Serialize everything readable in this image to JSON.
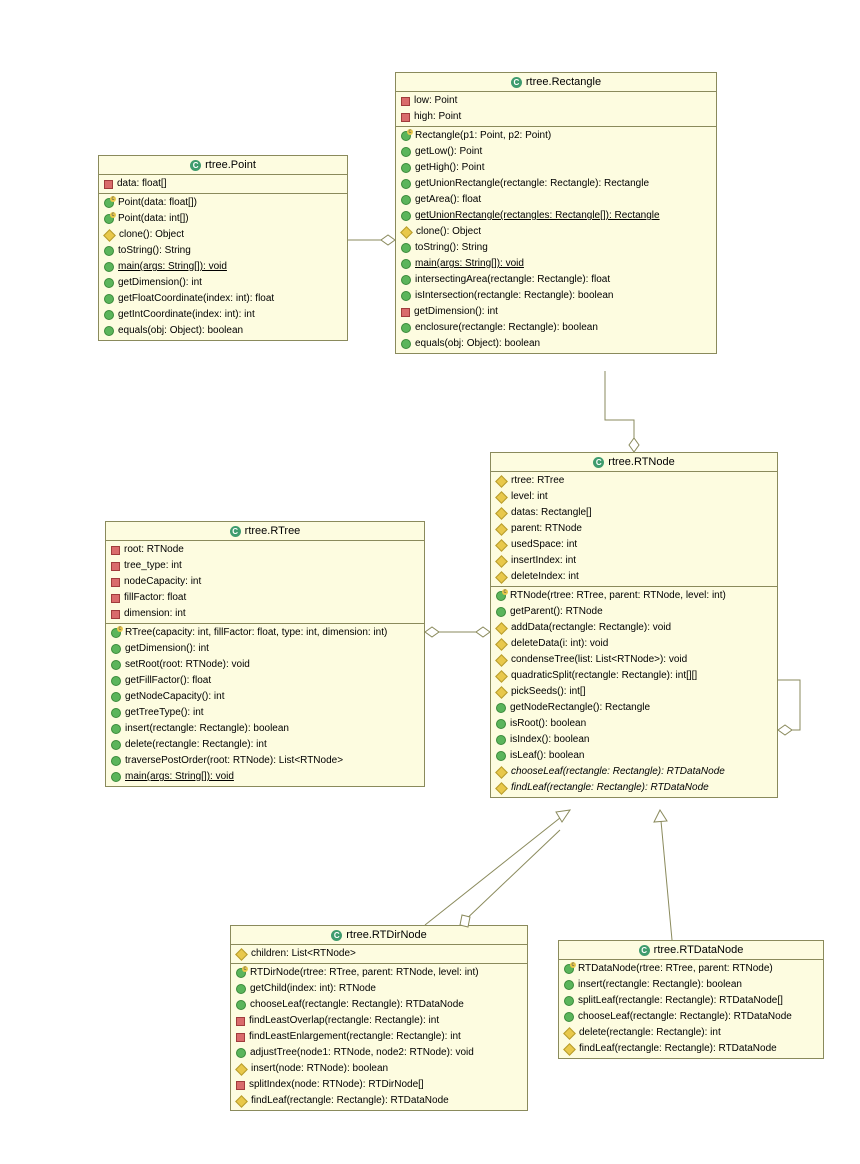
{
  "classes": {
    "point": {
      "title": "rtree.Point",
      "fields": [
        {
          "vis": "red-square",
          "text": "data: float[]"
        }
      ],
      "methods": [
        {
          "vis": "green-circle",
          "ctor": true,
          "text": "Point(data: float[])"
        },
        {
          "vis": "green-circle",
          "ctor": true,
          "text": "Point(data: int[])"
        },
        {
          "vis": "yellow-diamond",
          "text": "clone(): Object"
        },
        {
          "vis": "green-circle",
          "text": "toString(): String"
        },
        {
          "vis": "green-circle",
          "static": true,
          "text": "main(args: String[]): void"
        },
        {
          "vis": "green-circle",
          "text": "getDimension(): int"
        },
        {
          "vis": "green-circle",
          "text": "getFloatCoordinate(index: int): float"
        },
        {
          "vis": "green-circle",
          "text": "getIntCoordinate(index: int): int"
        },
        {
          "vis": "green-circle",
          "text": "equals(obj: Object): boolean"
        }
      ]
    },
    "rectangle": {
      "title": "rtree.Rectangle",
      "fields": [
        {
          "vis": "red-square",
          "text": "low: Point"
        },
        {
          "vis": "red-square",
          "text": "high: Point"
        }
      ],
      "methods": [
        {
          "vis": "green-circle",
          "ctor": true,
          "text": "Rectangle(p1: Point, p2: Point)"
        },
        {
          "vis": "green-circle",
          "text": "getLow(): Point"
        },
        {
          "vis": "green-circle",
          "text": "getHigh(): Point"
        },
        {
          "vis": "green-circle",
          "text": "getUnionRectangle(rectangle: Rectangle): Rectangle"
        },
        {
          "vis": "green-circle",
          "text": "getArea(): float"
        },
        {
          "vis": "green-circle",
          "static": true,
          "text": "getUnionRectangle(rectangles: Rectangle[]): Rectangle"
        },
        {
          "vis": "yellow-diamond",
          "text": "clone(): Object"
        },
        {
          "vis": "green-circle",
          "text": "toString(): String"
        },
        {
          "vis": "green-circle",
          "static": true,
          "text": "main(args: String[]): void"
        },
        {
          "vis": "green-circle",
          "text": "intersectingArea(rectangle: Rectangle): float"
        },
        {
          "vis": "green-circle",
          "text": "isIntersection(rectangle: Rectangle): boolean"
        },
        {
          "vis": "red-square",
          "text": "getDimension(): int"
        },
        {
          "vis": "green-circle",
          "text": "enclosure(rectangle: Rectangle): boolean"
        },
        {
          "vis": "green-circle",
          "text": "equals(obj: Object): boolean"
        }
      ]
    },
    "rtree": {
      "title": "rtree.RTree",
      "fields": [
        {
          "vis": "red-square",
          "text": "root: RTNode"
        },
        {
          "vis": "red-square",
          "text": "tree_type: int"
        },
        {
          "vis": "red-square",
          "text": "nodeCapacity: int"
        },
        {
          "vis": "red-square",
          "text": "fillFactor: float"
        },
        {
          "vis": "red-square",
          "text": "dimension: int"
        }
      ],
      "methods": [
        {
          "vis": "green-circle",
          "ctor": true,
          "text": "RTree(capacity: int, fillFactor: float, type: int, dimension: int)"
        },
        {
          "vis": "green-circle",
          "text": "getDimension(): int"
        },
        {
          "vis": "green-circle",
          "text": "setRoot(root: RTNode): void"
        },
        {
          "vis": "green-circle",
          "text": "getFillFactor(): float"
        },
        {
          "vis": "green-circle",
          "text": "getNodeCapacity(): int"
        },
        {
          "vis": "green-circle",
          "text": "getTreeType(): int"
        },
        {
          "vis": "green-circle",
          "text": "insert(rectangle: Rectangle): boolean"
        },
        {
          "vis": "green-circle",
          "text": "delete(rectangle: Rectangle): int"
        },
        {
          "vis": "green-circle",
          "text": "traversePostOrder(root: RTNode): List<RTNode>"
        },
        {
          "vis": "green-circle",
          "static": true,
          "text": "main(args: String[]): void"
        }
      ]
    },
    "rtnode": {
      "title": "rtree.RTNode",
      "fields": [
        {
          "vis": "yellow-diamond",
          "text": "rtree: RTree"
        },
        {
          "vis": "yellow-diamond",
          "text": "level: int"
        },
        {
          "vis": "yellow-diamond",
          "text": "datas: Rectangle[]"
        },
        {
          "vis": "yellow-diamond",
          "text": "parent: RTNode"
        },
        {
          "vis": "yellow-diamond",
          "text": "usedSpace: int"
        },
        {
          "vis": "yellow-diamond",
          "text": "insertIndex: int"
        },
        {
          "vis": "yellow-diamond",
          "text": "deleteIndex: int"
        }
      ],
      "methods": [
        {
          "vis": "green-circle",
          "ctor": true,
          "text": "RTNode(rtree: RTree, parent: RTNode, level: int)"
        },
        {
          "vis": "green-circle",
          "text": "getParent(): RTNode"
        },
        {
          "vis": "yellow-diamond",
          "text": "addData(rectangle: Rectangle): void"
        },
        {
          "vis": "yellow-diamond",
          "text": "deleteData(i: int): void"
        },
        {
          "vis": "yellow-diamond",
          "text": "condenseTree(list: List<RTNode>): void"
        },
        {
          "vis": "yellow-diamond",
          "text": "quadraticSplit(rectangle: Rectangle): int[][]"
        },
        {
          "vis": "yellow-diamond",
          "text": "pickSeeds(): int[]"
        },
        {
          "vis": "green-circle",
          "text": "getNodeRectangle(): Rectangle"
        },
        {
          "vis": "green-circle",
          "text": "isRoot(): boolean"
        },
        {
          "vis": "green-circle",
          "text": "isIndex(): boolean"
        },
        {
          "vis": "green-circle",
          "text": "isLeaf(): boolean"
        },
        {
          "vis": "yellow-diamond",
          "abstract": true,
          "text": "chooseLeaf(rectangle: Rectangle): RTDataNode"
        },
        {
          "vis": "yellow-diamond",
          "abstract": true,
          "text": "findLeaf(rectangle: Rectangle): RTDataNode"
        }
      ]
    },
    "rtdirnode": {
      "title": "rtree.RTDirNode",
      "fields": [
        {
          "vis": "yellow-diamond",
          "text": "children: List<RTNode>"
        }
      ],
      "methods": [
        {
          "vis": "green-circle",
          "ctor": true,
          "text": "RTDirNode(rtree: RTree, parent: RTNode, level: int)"
        },
        {
          "vis": "green-circle",
          "text": "getChild(index: int): RTNode"
        },
        {
          "vis": "green-circle",
          "text": "chooseLeaf(rectangle: Rectangle): RTDataNode"
        },
        {
          "vis": "red-square",
          "text": "findLeastOverlap(rectangle: Rectangle): int"
        },
        {
          "vis": "red-square",
          "text": "findLeastEnlargement(rectangle: Rectangle): int"
        },
        {
          "vis": "green-circle",
          "text": "adjustTree(node1: RTNode, node2: RTNode): void"
        },
        {
          "vis": "yellow-diamond",
          "text": "insert(node: RTNode): boolean"
        },
        {
          "vis": "red-square",
          "text": "splitIndex(node: RTNode): RTDirNode[]"
        },
        {
          "vis": "yellow-diamond",
          "text": "findLeaf(rectangle: Rectangle): RTDataNode"
        }
      ]
    },
    "rtdatanode": {
      "title": "rtree.RTDataNode",
      "fields": [],
      "methods": [
        {
          "vis": "green-circle",
          "ctor": true,
          "text": "RTDataNode(rtree: RTree, parent: RTNode)"
        },
        {
          "vis": "green-circle",
          "text": "insert(rectangle: Rectangle): boolean"
        },
        {
          "vis": "green-circle",
          "text": "splitLeaf(rectangle: Rectangle): RTDataNode[]"
        },
        {
          "vis": "green-circle",
          "text": "chooseLeaf(rectangle: Rectangle): RTDataNode"
        },
        {
          "vis": "yellow-diamond",
          "text": "delete(rectangle: Rectangle): int"
        },
        {
          "vis": "yellow-diamond",
          "text": "findLeaf(rectangle: Rectangle): RTDataNode"
        }
      ]
    }
  }
}
